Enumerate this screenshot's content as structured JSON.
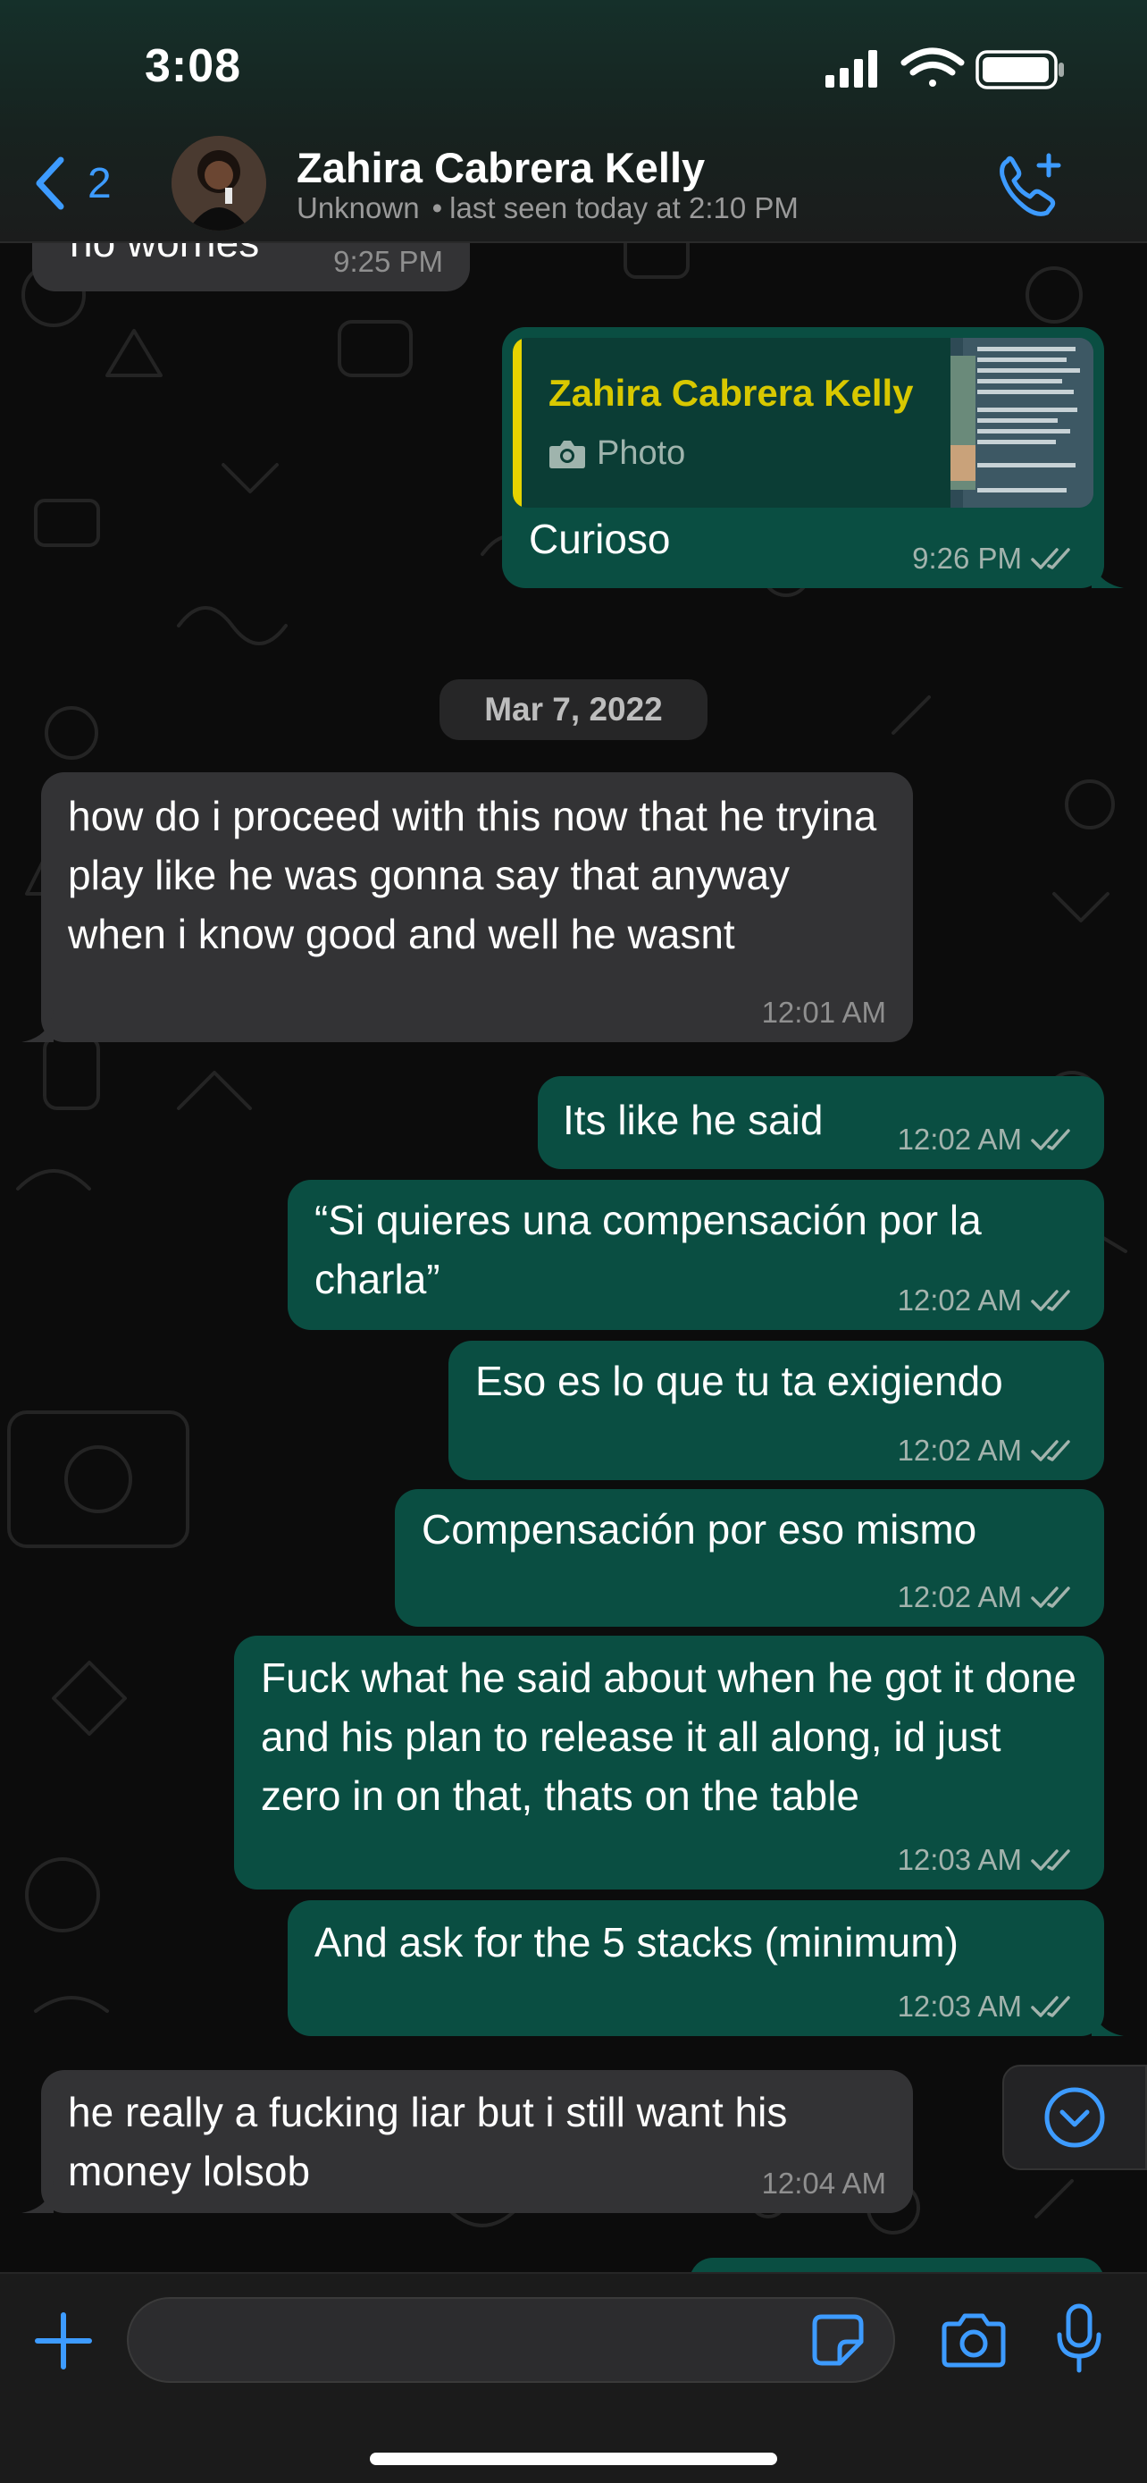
{
  "status_bar": {
    "time": "3:08",
    "icons": [
      "signal-icon",
      "wifi-icon",
      "battery-icon"
    ]
  },
  "header": {
    "back_count": "2",
    "contact_name": "Zahira Cabrera Kelly",
    "contact_status_left": "Unknown",
    "contact_status_right": "last seen today at 2:10 PM",
    "call_icon": "phone-plus-icon"
  },
  "messages": {
    "m0": {
      "text": "no worries",
      "time": "9:25 PM",
      "direction": "in"
    },
    "m1": {
      "quote_name": "Zahira Cabrera Kelly",
      "quote_type": "Photo",
      "text": "Curioso",
      "time": "9:26 PM",
      "direction": "out"
    },
    "date_chip": "Mar 7, 2022",
    "m2": {
      "text": "how do i proceed with this now that he tryina play like he was gonna say that anyway when i know good and well he wasnt",
      "time": "12:01 AM",
      "direction": "in"
    },
    "m3": {
      "text": "Its like he said",
      "time": "12:02 AM",
      "direction": "out"
    },
    "m4": {
      "text": "“Si quieres una compensación por la charla”",
      "time": "12:02 AM",
      "direction": "out"
    },
    "m5": {
      "text": "Eso es lo que tu ta exigiendo",
      "time": "12:02 AM",
      "direction": "out"
    },
    "m6": {
      "text": "Compensación por eso mismo",
      "time": "12:02 AM",
      "direction": "out"
    },
    "m7": {
      "text": "Fuck what he said about when he got it done and his plan to release it all along, id just zero in on that, thats on the table",
      "time": "12:03 AM",
      "direction": "out"
    },
    "m8": {
      "text": "And ask for the 5 stacks (minimum)",
      "time": "12:03 AM",
      "direction": "out"
    },
    "m9": {
      "text": "he really a fucking liar but i still want his money lolsob",
      "time": "12:04 AM",
      "direction": "in"
    }
  },
  "input_bar": {
    "placeholder": "",
    "icons": [
      "plus-icon",
      "sticker-icon",
      "camera-icon",
      "microphone-icon"
    ]
  },
  "colors": {
    "accent": "#3d9bff",
    "outgoing_bubble": "#0a4e42",
    "incoming_bubble": "#333335",
    "quote_name": "#d8c800"
  }
}
